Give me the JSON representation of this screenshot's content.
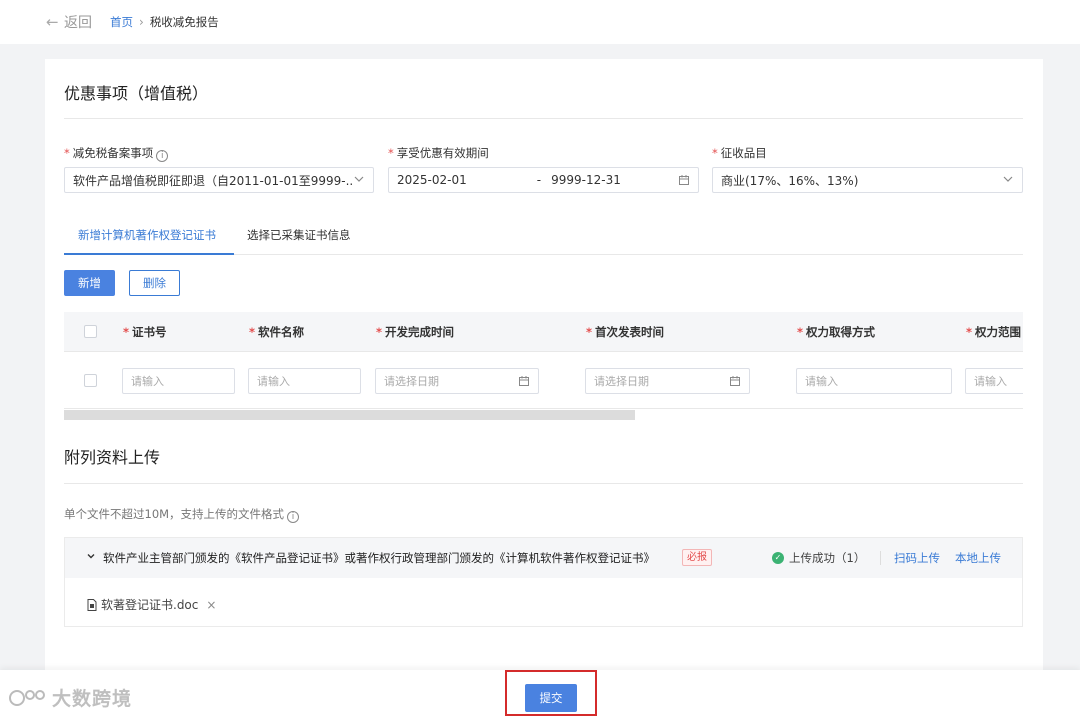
{
  "topbar": {
    "back_label": "返回",
    "breadcrumb": {
      "home": "首页",
      "separator": "›",
      "current": "税收减免报告"
    }
  },
  "vat_section": {
    "title": "优惠事项（增值税）",
    "fields": {
      "filing_item": {
        "label": "减免税备案事项",
        "value": "软件产品增值税即征即退（自2011-01-01至9999-..."
      },
      "valid_period": {
        "label": "享受优惠有效期间",
        "start": "2025-02-01",
        "separator": "-",
        "end": "9999-12-31"
      },
      "tax_item": {
        "label": "征收品目",
        "value": "商业(17%、16%、13%)"
      }
    }
  },
  "tabs": [
    {
      "label": "新增计算机著作权登记证书",
      "active": true
    },
    {
      "label": "选择已采集证书信息",
      "active": false
    }
  ],
  "actions": {
    "add_label": "新增",
    "delete_label": "删除"
  },
  "table": {
    "columns": [
      "证书号",
      "软件名称",
      "开发完成时间",
      "首次发表时间",
      "权力取得方式",
      "权力范围"
    ],
    "row": {
      "placeholders": [
        "请输入",
        "请输入",
        "请选择日期",
        "请选择日期",
        "请输入",
        "请输入"
      ]
    }
  },
  "upload_section": {
    "title": "附列资料上传",
    "hint": "单个文件不超过10M，支持上传的文件格式",
    "item": {
      "title": "软件产业主管部门颁发的《软件产品登记证书》或著作权行政管理部门颁发的《计算机软件著作权登记证书》",
      "required_badge": "必报",
      "status": "上传成功（1）",
      "scan_upload": "扫码上传",
      "local_upload": "本地上传",
      "files": [
        "软著登记证书.doc"
      ]
    }
  },
  "footer": {
    "submit_label": "提交"
  },
  "watermark": {
    "text": "大数跨境"
  },
  "colors": {
    "primary": "#4a82e0",
    "link": "#3a7bd5",
    "required": "#e34d4d",
    "success": "#3bb273",
    "highlight_frame": "#d42b2b"
  },
  "icons": [
    "back-arrow-icon",
    "info-icon",
    "chevron-down-icon",
    "calendar-icon",
    "caret-down-icon",
    "check-circle-icon",
    "file-icon",
    "close-icon"
  ]
}
